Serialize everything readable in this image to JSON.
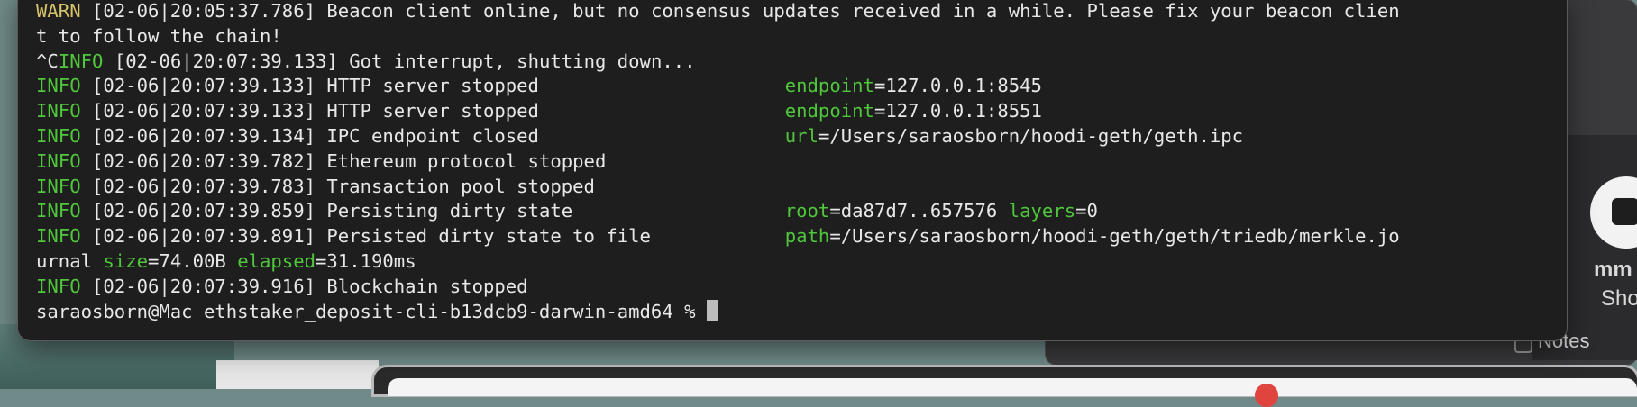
{
  "background": {
    "partial_text_1": "mm",
    "partial_text_2": "Sho",
    "partial_text_3": "Notes"
  },
  "terminal": {
    "lines": [
      {
        "level": "WARN",
        "text": "[02-06|20:05:37.786] Beacon client online, but no consensus updates received in a while. Please fix your beacon clien"
      },
      {
        "text": "t to follow the chain!"
      },
      {
        "prefix": "^C",
        "level": "INFO",
        "text": "[02-06|20:07:39.133] Got interrupt, shutting down..."
      },
      {
        "level": "INFO",
        "text": "[02-06|20:07:39.133] HTTP server stopped                      ",
        "kv": [
          {
            "k": "endpoint",
            "v": "127.0.0.1:8545"
          }
        ]
      },
      {
        "level": "INFO",
        "text": "[02-06|20:07:39.133] HTTP server stopped                      ",
        "kv": [
          {
            "k": "endpoint",
            "v": "127.0.0.1:8551"
          }
        ]
      },
      {
        "level": "INFO",
        "text": "[02-06|20:07:39.134] IPC endpoint closed                      ",
        "kv": [
          {
            "k": "url",
            "v": "/Users/saraosborn/hoodi-geth/geth.ipc"
          }
        ]
      },
      {
        "level": "INFO",
        "text": "[02-06|20:07:39.782] Ethereum protocol stopped"
      },
      {
        "level": "INFO",
        "text": "[02-06|20:07:39.783] Transaction pool stopped"
      },
      {
        "level": "INFO",
        "text": "[02-06|20:07:39.859] Persisting dirty state                   ",
        "kv": [
          {
            "k": "root",
            "v": "da87d7..657576 "
          },
          {
            "k": "layers",
            "v": "0"
          }
        ]
      },
      {
        "level": "INFO",
        "text": "[02-06|20:07:39.891] Persisted dirty state to file            ",
        "kv": [
          {
            "k": "path",
            "v": "/Users/saraosborn/hoodi-geth/geth/triedb/merkle.jo"
          }
        ]
      },
      {
        "text": "urnal ",
        "kv": [
          {
            "k": "size",
            "v": "74.00B "
          },
          {
            "k": "elapsed",
            "v": "31.190ms"
          }
        ]
      },
      {
        "level": "INFO",
        "text": "[02-06|20:07:39.916] Blockchain stopped"
      }
    ],
    "prompt": "saraosborn@Mac ethstaker_deposit-cli-b13dcb9-darwin-amd64 % "
  }
}
